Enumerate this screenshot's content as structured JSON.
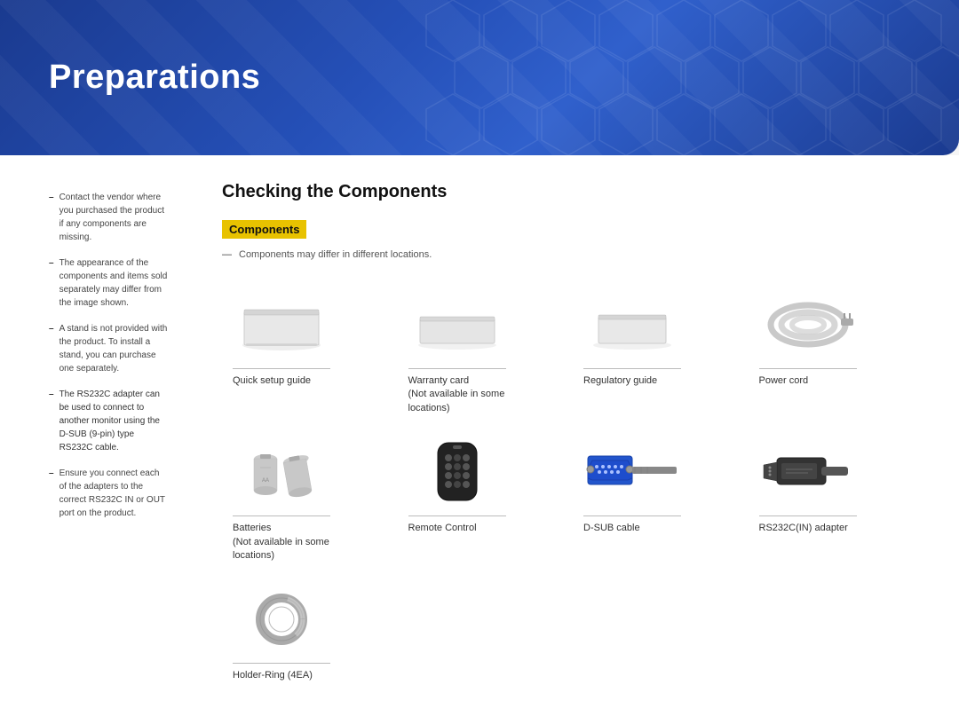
{
  "header": {
    "title": "Preparations"
  },
  "sidebar": {
    "items": [
      {
        "text": "Contact the vendor where you purchased the product if any components are missing."
      },
      {
        "text": "The appearance of the components and items sold separately may differ from the image shown."
      },
      {
        "text": "A stand is not provided with the product. To install a stand, you can purchase one separately."
      },
      {
        "text": "The RS232C adapter can be used to connect to another monitor using the D-SUB (9-pin) type RS232C cable.",
        "highlighted": true
      },
      {
        "text": "Ensure you connect each of the adapters to the correct RS232C IN or OUT port on the product."
      }
    ]
  },
  "content": {
    "section_title": "Checking the Components",
    "badge": "Components",
    "note": "Components may differ in different locations.",
    "components": [
      {
        "id": "quick-setup-guide",
        "label": "Quick setup guide",
        "sublabel": ""
      },
      {
        "id": "warranty-card",
        "label": "Warranty card",
        "sublabel": "(Not available in some locations)"
      },
      {
        "id": "regulatory-guide",
        "label": "Regulatory guide",
        "sublabel": ""
      },
      {
        "id": "power-cord",
        "label": "Power cord",
        "sublabel": ""
      },
      {
        "id": "batteries",
        "label": "Batteries",
        "sublabel": "(Not available in some locations)"
      },
      {
        "id": "remote-control",
        "label": "Remote Control",
        "sublabel": ""
      },
      {
        "id": "dsub-cable",
        "label": "D-SUB cable",
        "sublabel": ""
      },
      {
        "id": "rs232c-adapter",
        "label": "RS232C(IN) adapter",
        "sublabel": ""
      },
      {
        "id": "holder-ring",
        "label": "Holder-Ring (4EA)",
        "sublabel": ""
      }
    ]
  }
}
